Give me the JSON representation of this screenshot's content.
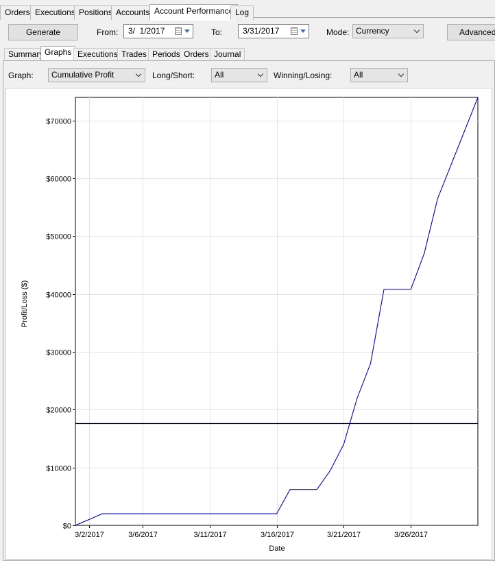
{
  "top_tabs": [
    {
      "label": "Orders",
      "active": false
    },
    {
      "label": "Executions",
      "active": false
    },
    {
      "label": "Positions",
      "active": false
    },
    {
      "label": "Accounts",
      "active": false
    },
    {
      "label": "Account Performance",
      "active": true
    },
    {
      "label": "Log",
      "active": false
    }
  ],
  "toolbar": {
    "generate_label": "Generate",
    "from_label": "From:",
    "from_value": "3/  1/2017",
    "to_label": "To:",
    "to_value": "3/31/2017",
    "mode_label": "Mode:",
    "mode_value": "Currency",
    "advanced_label": "Advanced"
  },
  "sub_tabs": [
    {
      "label": "Summary",
      "active": false
    },
    {
      "label": "Graphs",
      "active": true
    },
    {
      "label": "Executions",
      "active": false
    },
    {
      "label": "Trades",
      "active": false
    },
    {
      "label": "Periods",
      "active": false
    },
    {
      "label": "Orders",
      "active": false
    },
    {
      "label": "Journal",
      "active": false
    }
  ],
  "filters": {
    "graph_label": "Graph:",
    "graph_value": "Cumulative Profit",
    "longshort_label": "Long/Short:",
    "longshort_value": "All",
    "winlose_label": "Winning/Losing:",
    "winlose_value": "All"
  },
  "chart_data": {
    "type": "line",
    "xlabel": "Date",
    "ylabel": "Profit/Loss ($)",
    "x_ticks": [
      "3/2/2017",
      "3/6/2017",
      "3/11/2017",
      "3/16/2017",
      "3/21/2017",
      "3/26/2017"
    ],
    "y_ticks": [
      "$0",
      "$10000",
      "$20000",
      "$30000",
      "$40000",
      "$50000",
      "$60000",
      "$70000"
    ],
    "ylim": [
      0,
      74000
    ],
    "xlim": [
      "2017-03-01",
      "2017-03-31"
    ],
    "grid": true,
    "series": [
      {
        "color": "#0000cc",
        "x": [
          "2017-03-01",
          "2017-03-02",
          "2017-03-03",
          "2017-03-16",
          "2017-03-17",
          "2017-03-19",
          "2017-03-20",
          "2017-03-21",
          "2017-03-22",
          "2017-03-23",
          "2017-03-24",
          "2017-03-26",
          "2017-03-27",
          "2017-03-28",
          "2017-03-31"
        ],
        "y": [
          0,
          1000,
          2000,
          2000,
          6200,
          6200,
          9500,
          14000,
          22000,
          28000,
          40800,
          40800,
          47000,
          56500,
          74000
        ]
      }
    ],
    "reference_line": {
      "y": 17700,
      "color": "#000066"
    }
  }
}
